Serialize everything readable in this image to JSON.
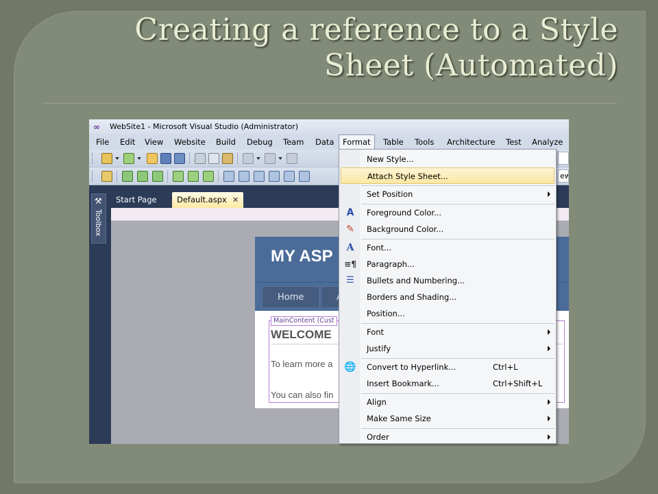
{
  "slide": {
    "title_line1": "Creating a reference to a Style",
    "title_line2": "Sheet (Automated)"
  },
  "window": {
    "title": "WebSite1 - Microsoft Visual Studio (Administrator)"
  },
  "menubar": {
    "items": [
      "File",
      "Edit",
      "View",
      "Website",
      "Build",
      "Debug",
      "Team",
      "Data",
      "Format",
      "Table",
      "Tools",
      "Architecture",
      "Test",
      "Analyze"
    ],
    "active": "Format"
  },
  "toolbar2": {
    "partial_input": "ew"
  },
  "toolbox": {
    "label": "Toolbox"
  },
  "doc_tabs": {
    "tab1": "Start Page",
    "tab2": "Default.aspx",
    "close": "✕"
  },
  "page": {
    "header": "MY ASP",
    "nav_home": "Home",
    "nav_second": "A",
    "content_label": "MainContent (Cust",
    "heading": "WELCOME",
    "para1": "To learn more a",
    "para2": "You can also fin"
  },
  "format_menu": {
    "items": [
      {
        "label": "New Style...",
        "icon": "",
        "shortcut": "",
        "submenu": false
      },
      {
        "label": "Attach Style Sheet...",
        "icon": "",
        "shortcut": "",
        "submenu": false,
        "highlighted": true
      },
      {
        "label": "Set Position",
        "icon": "",
        "shortcut": "",
        "submenu": true
      },
      {
        "label": "Foreground Color...",
        "icon": "foreground-color-icon",
        "shortcut": "",
        "submenu": false
      },
      {
        "label": "Background Color...",
        "icon": "background-color-icon",
        "shortcut": "",
        "submenu": false
      },
      {
        "label": "Font...",
        "icon": "font-icon",
        "shortcut": "",
        "submenu": false
      },
      {
        "label": "Paragraph...",
        "icon": "paragraph-icon",
        "shortcut": "",
        "submenu": false
      },
      {
        "label": "Bullets and Numbering...",
        "icon": "bullets-icon",
        "shortcut": "",
        "submenu": false
      },
      {
        "label": "Borders and Shading...",
        "icon": "",
        "shortcut": "",
        "submenu": false
      },
      {
        "label": "Position...",
        "icon": "",
        "shortcut": "",
        "submenu": false
      },
      {
        "label": "Font",
        "icon": "",
        "shortcut": "",
        "submenu": true
      },
      {
        "label": "Justify",
        "icon": "",
        "shortcut": "",
        "submenu": true
      },
      {
        "label": "Convert to Hyperlink...",
        "icon": "hyperlink-icon",
        "shortcut": "Ctrl+L",
        "submenu": false
      },
      {
        "label": "Insert Bookmark...",
        "icon": "",
        "shortcut": "Ctrl+Shift+L",
        "submenu": false
      },
      {
        "label": "Align",
        "icon": "",
        "shortcut": "",
        "submenu": true
      },
      {
        "label": "Make Same Size",
        "icon": "",
        "shortcut": "",
        "submenu": true
      },
      {
        "label": "Order",
        "icon": "",
        "shortcut": "",
        "submenu": true
      }
    ]
  }
}
